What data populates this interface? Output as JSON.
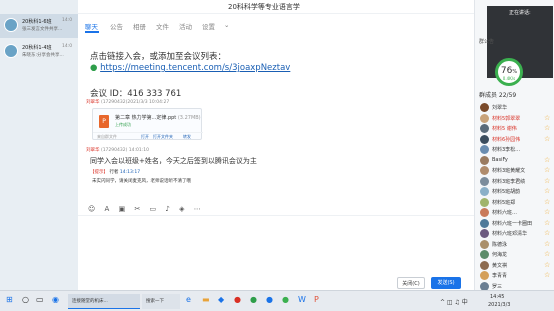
{
  "chat_list": [
    {
      "name": "20秋科1-6班",
      "time": "14:0",
      "preview": "张三发言文件共享..."
    },
    {
      "name": "20秋科1-4班",
      "time": "14:0",
      "preview": "朱晓东:分享会共享..."
    }
  ],
  "window": {
    "title": "20科科学等专业语言学"
  },
  "tabs": {
    "chat": "聊天",
    "announcement": "公告",
    "album": "相册",
    "files": "文件",
    "activity": "活动",
    "settings": "设置"
  },
  "messages": {
    "line1": "点击链接入会，或添加至会议列表：",
    "link": "https://meeting.tencent.com/s/3joaxpNeztav",
    "meeting_id": "会议 ID：416 333 761",
    "sender1_name": "刘翠华",
    "sender1_meta": "(17290432)2021/3/3 10:04:27",
    "file_name": "第二章 热力学第...定律.ppt",
    "file_size": "(3.27MB)",
    "file_status": "上传成功",
    "file_source": "来自群文件",
    "file_open": "打开",
    "file_open_folder": "打开文件夹",
    "file_forward": "转发",
    "sender2_name": "刘翠华",
    "sender2_meta": "(17290432) 14:01:10",
    "line2": "同学入会以班级+姓名，今天之后签到以腾讯会议为主",
    "notice_tag": "【提示】",
    "notice_user": "行者",
    "notice_time": "14:13:17",
    "notice_text": "未实闪同学，请关闭麦克风，老师说话听不清了哦"
  },
  "toolbar_icons": [
    "emoji-icon",
    "font-icon",
    "image-icon",
    "screenshot-icon",
    "folder-icon",
    "mic-icon",
    "shake-icon",
    "more-icon"
  ],
  "buttons": {
    "close": "关闭(C)",
    "send": "发送(S)"
  },
  "right_panel": {
    "video_label": "正在讲话:",
    "speed_pct": "76",
    "speed_unit": "%",
    "speed_rate": "0.4K/s",
    "announcement": "群公告",
    "member_count": "群成员 22/59"
  },
  "members": [
    {
      "name": "刘翠华",
      "red": false,
      "star": false,
      "color": "#7a4a2a"
    },
    {
      "name": "材料5郭翠翠",
      "red": true,
      "star": true,
      "color": "#c9a37a"
    },
    {
      "name": "材料5 谢伟",
      "red": true,
      "star": true,
      "color": "#5a6b7a"
    },
    {
      "name": "材料6孙园伟",
      "red": true,
      "star": true,
      "color": "#3b4d5e"
    },
    {
      "name": "材料3李松…",
      "red": false,
      "star": false,
      "color": "#6a8db0"
    },
    {
      "name": "BasiFy",
      "red": false,
      "star": true,
      "color": "#9a7b60"
    },
    {
      "name": "材料3班黄耀文",
      "red": false,
      "star": true,
      "color": "#b08c6c"
    },
    {
      "name": "材料3班李君绩",
      "red": false,
      "star": true,
      "color": "#7c8d9c"
    },
    {
      "name": "材料5班胡韵",
      "red": false,
      "star": true,
      "color": "#8ab0c8"
    },
    {
      "name": "材料5班郑",
      "red": false,
      "star": true,
      "color": "#a0b46b"
    },
    {
      "name": "材料六班…",
      "red": false,
      "star": true,
      "color": "#c97a5a"
    },
    {
      "name": "材料六班一卡圈田",
      "red": false,
      "star": true,
      "color": "#4f7a9a"
    },
    {
      "name": "材料六班邓清华",
      "red": false,
      "star": true,
      "color": "#6b5a80"
    },
    {
      "name": "陈德泳",
      "red": false,
      "star": true,
      "color": "#aa8f6a"
    },
    {
      "name": "何海龙",
      "red": false,
      "star": true,
      "color": "#5c8c6a"
    },
    {
      "name": "黄文祺",
      "red": false,
      "star": true,
      "color": "#8c6b50"
    },
    {
      "name": "李青青",
      "red": false,
      "star": true,
      "color": "#d4a05a"
    },
    {
      "name": "罗三",
      "red": false,
      "star": false,
      "color": "#6a7f93"
    }
  ],
  "taskbar": {
    "app_label": "连接随堂的机床...",
    "app2_label": "搜索一下",
    "time": "14:45",
    "date": "2021/3/3"
  }
}
